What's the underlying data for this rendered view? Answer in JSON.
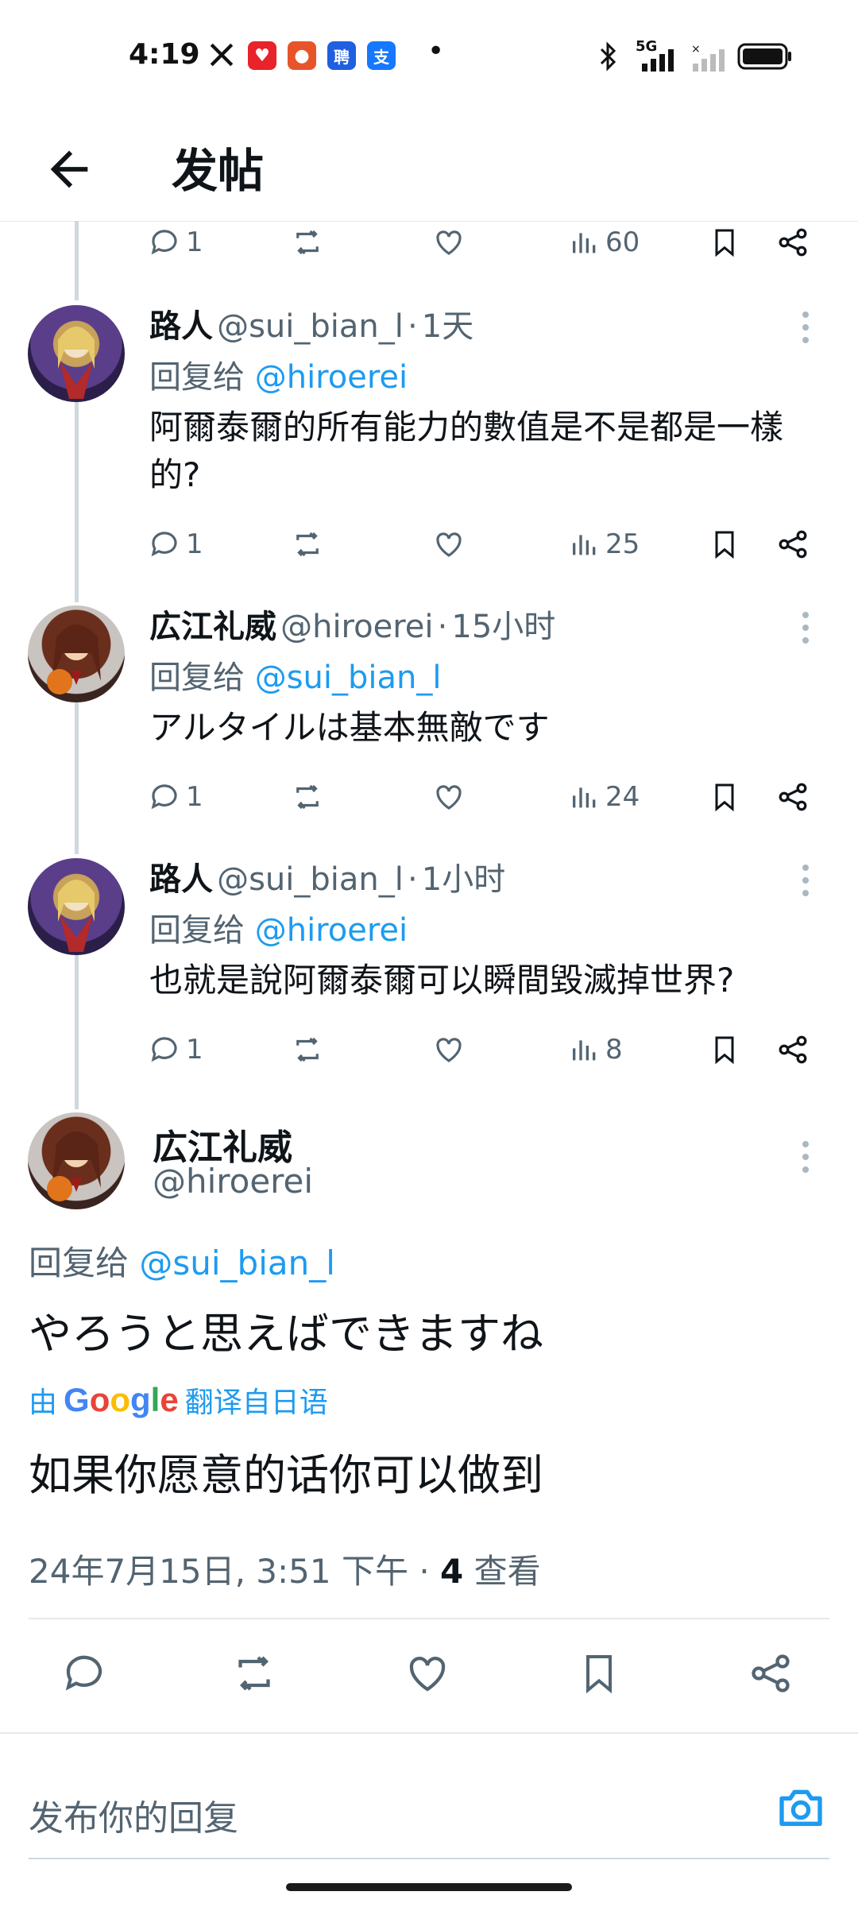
{
  "status_bar": {
    "time": "4:19",
    "x_app_icon": "x-logo-icon",
    "app_icons": [
      {
        "name": "red-app-icon",
        "glyph": "♥",
        "color": "#e8232a"
      },
      {
        "name": "red-bear-app-icon",
        "glyph": "●",
        "color": "#e8542a"
      },
      {
        "name": "pin-app-icon",
        "glyph": "聘",
        "color": "#1f5fe0"
      },
      {
        "name": "alipay-app-icon",
        "glyph": "支",
        "color": "#1677ff"
      }
    ],
    "dot": "•",
    "network": "5G"
  },
  "header": {
    "title": "发帖"
  },
  "thread": [
    {
      "id": "partial",
      "actions": {
        "replies": "1",
        "views": "60"
      }
    },
    {
      "id": "t1",
      "name": "路人",
      "handle": "@sui_bian_l",
      "time": "1天",
      "reply_prefix": "回复给",
      "reply_to": "@hiroerei",
      "text_line1": "阿爾泰爾的所有能力的數值是不是都是一樣",
      "text_line2": "的?",
      "actions": {
        "replies": "1",
        "views": "25"
      }
    },
    {
      "id": "t2",
      "name": "広江礼威",
      "handle": "@hiroerei",
      "time": "15小时",
      "reply_prefix": "回复给",
      "reply_to": "@sui_bian_l",
      "text_line1": "アルタイルは基本無敵です",
      "actions": {
        "replies": "1",
        "views": "24"
      }
    },
    {
      "id": "t3",
      "name": "路人",
      "handle": "@sui_bian_l",
      "time": "1小时",
      "reply_prefix": "回复给",
      "reply_to": "@hiroerei",
      "text_line1": "也就是說阿爾泰爾可以瞬間毀滅掉世界?",
      "actions": {
        "replies": "1",
        "views": "8"
      }
    }
  ],
  "main_tweet": {
    "name": "広江礼威",
    "handle": "@hiroerei",
    "reply_prefix": "回复给",
    "reply_to": "@sui_bian_l",
    "text": "やろうと思えばできますね",
    "translate_prefix": "由",
    "translate_brand": "Google",
    "translate_suffix": "翻译自日语",
    "translated_text": "如果你愿意的话你可以做到",
    "timestamp": "24年7月15日, 3:51 下午",
    "views_count": "4",
    "views_label": "查看"
  },
  "reply_bar": {
    "placeholder": "发布你的回复"
  },
  "colors": {
    "link": "#1d9bf0",
    "secondary": "#536471",
    "primary_text": "#0f1419",
    "thread_line": "#cfd9de"
  }
}
